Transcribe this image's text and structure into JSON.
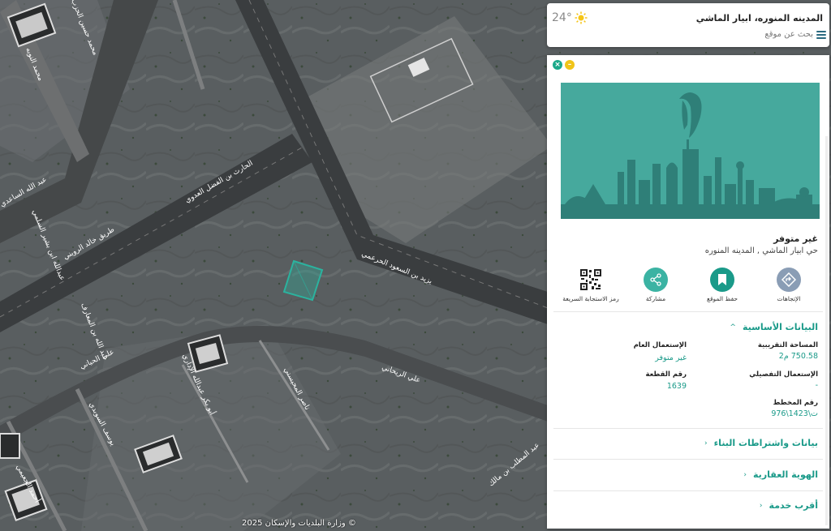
{
  "header": {
    "temperature": "24°",
    "weather_icon": "sun-icon",
    "location_title": "المدينه المنوره، ابيار الماشي",
    "search_placeholder": "بحث عن موقع"
  },
  "map": {
    "copyright": "وزارة البلديات والإسكان 2025 ©",
    "road_labels": [
      "طريق خالد الرويني",
      "عبد الله الساعدي",
      "محمد حسين الحزب",
      "محمد النوبه",
      "عبدالله ابن بشير السلمي",
      "الحارث بن الفضل العدوي",
      "يزيد بن السعود الحرعمي",
      "عبد الله بن المعارف",
      "علي الريحاني",
      "علي الحياني",
      "أبو بكر عبدالله الإداري",
      "ناصر المحيسني",
      "يوسف السوبدي",
      "أحمد الجعيمي",
      "عبد المطلب بن مالك"
    ]
  },
  "panel": {
    "status": "غير متوفر",
    "district": "حي ابيار الماشي , المدينه المنوره",
    "actions": [
      {
        "label": "الإتجاهات",
        "icon": "directions-icon",
        "color": "#8a9db5"
      },
      {
        "label": "حفظ الموقع",
        "icon": "bookmark-icon",
        "color": "#1a9a89"
      },
      {
        "label": "مشاركة",
        "icon": "share-icon",
        "color": "#3bb3a3"
      },
      {
        "label": "رمز الاستجابة السريعة",
        "icon": "qr-code-icon",
        "color": "#222222"
      }
    ],
    "basic_data": {
      "title": "البيانات الأساسية",
      "fields": [
        {
          "label": "المساحة التقريبية",
          "value": "750.58 م2"
        },
        {
          "label": "الإستعمال العام",
          "value": "غير متوفر"
        },
        {
          "label": "الإستعمال التفصيلي",
          "value": "-"
        },
        {
          "label": "رقم القطعة",
          "value": "1639"
        },
        {
          "label": "رقم المخطط",
          "value": "ت\\1423\\976"
        }
      ]
    },
    "sections": [
      "بيانات واشتراطات البناء",
      "الهوية العقارية",
      "أقرب خدمة"
    ]
  }
}
